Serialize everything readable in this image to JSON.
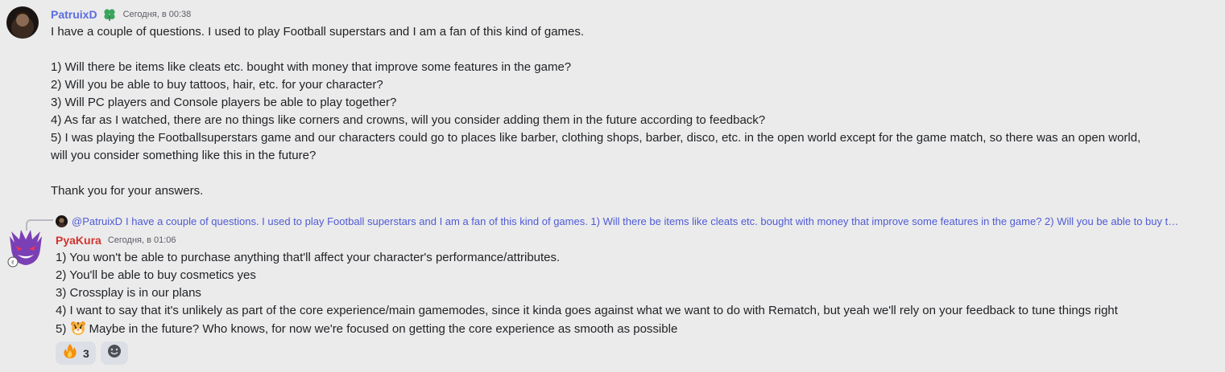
{
  "messages": [
    {
      "username": "PatruixD",
      "timestamp": "Сегодня, в 00:38",
      "text": "I have a couple of questions. I used to play Football superstars and I am a fan of this kind of games.\n\n1) Will there be items like cleats etc. bought with money that improve some features in the game?\n2) Will you be able to buy tattoos, hair, etc. for your character?\n3) Will PC players and Console players be able to play together?\n4) As far as I watched, there are no things like corners and crowns, will you consider adding them in the future according to feedback?\n5) I was playing the Footballsuperstars game and our characters could go to places like barber, clothing shops, barber, disco, etc. in the open world except for the game match, so there was an open world,\nwill you consider something like this in the future?\n\nThank you for your answers.",
      "badge_icon": "clover-icon"
    },
    {
      "reply": {
        "mention": "@PatruixD",
        "text": "I have a couple of questions. I used to play Football superstars and I am a fan of this kind of games.   1) Will there be items like cleats etc. bought with money that improve some features in the game? 2) Will you be able to buy t…"
      },
      "username": "PyaKura",
      "timestamp": "Сегодня, в 01:06",
      "lines": [
        "1) You won't be able to purchase anything that'll affect your character's performance/attributes.",
        "2) You'll be able to buy cosmetics yes",
        "3) Crossplay is in our plans",
        "4) I want to say that it's unlikely as part of the core experience/main gamemodes, since it kinda goes against what we want to do with Rematch, but yeah we'll rely on your feedback to tune things right"
      ],
      "line5_prefix": "5) ",
      "line5_text": "Maybe in the future? Who knows, for now we're focused on getting the core experience as smooth as possible",
      "reactions": [
        {
          "emoji": "fire-icon",
          "count": "3"
        }
      ],
      "add_reaction_icon": "smiley-icon"
    }
  ],
  "colors": {
    "background": "#ebebeb",
    "user1": "#5b6dde",
    "user2": "#d23430",
    "mention": "#4f5bd5"
  }
}
